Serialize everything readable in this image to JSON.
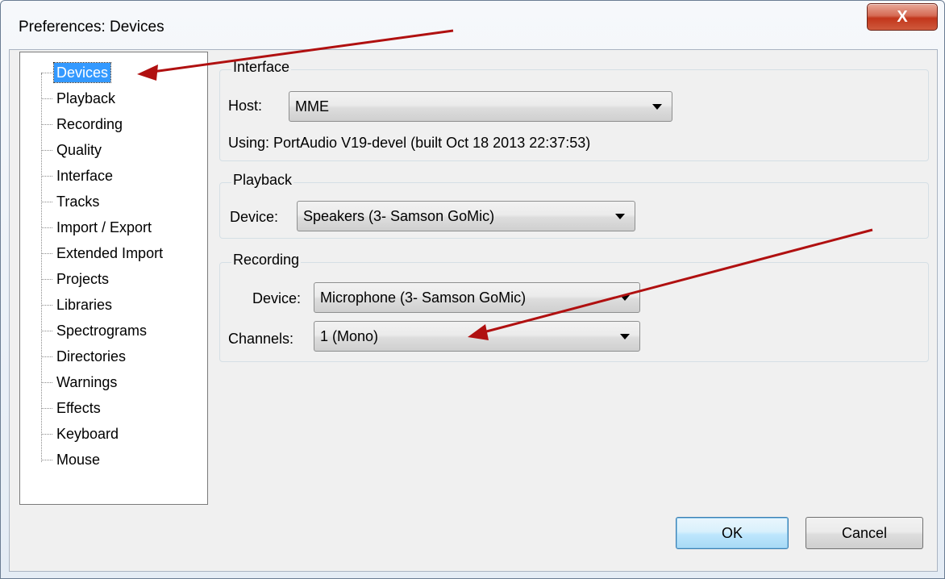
{
  "window": {
    "title": "Preferences: Devices",
    "close_label": "X"
  },
  "tree": {
    "selected": "Devices",
    "items": [
      {
        "label": "Devices"
      },
      {
        "label": "Playback"
      },
      {
        "label": "Recording"
      },
      {
        "label": "Quality"
      },
      {
        "label": "Interface"
      },
      {
        "label": "Tracks"
      },
      {
        "label": "Import / Export"
      },
      {
        "label": "Extended Import"
      },
      {
        "label": "Projects"
      },
      {
        "label": "Libraries"
      },
      {
        "label": "Spectrograms"
      },
      {
        "label": "Directories"
      },
      {
        "label": "Warnings"
      },
      {
        "label": "Effects"
      },
      {
        "label": "Keyboard"
      },
      {
        "label": "Mouse"
      }
    ]
  },
  "interface_group": {
    "title": "Interface",
    "host_label": "Host:",
    "host_value": "MME",
    "using_text": "Using: PortAudio V19-devel (built Oct 18 2013 22:37:53)"
  },
  "playback_group": {
    "title": "Playback",
    "device_label": "Device:",
    "device_value": "Speakers (3- Samson GoMic)"
  },
  "recording_group": {
    "title": "Recording",
    "device_label": "Device:",
    "device_value": "Microphone (3- Samson GoMic)",
    "channels_label": "Channels:",
    "channels_value": "1 (Mono)"
  },
  "buttons": {
    "ok": "OK",
    "cancel": "Cancel"
  },
  "colors": {
    "annotation_arrow": "#b01010",
    "selection": "#3399ff"
  }
}
